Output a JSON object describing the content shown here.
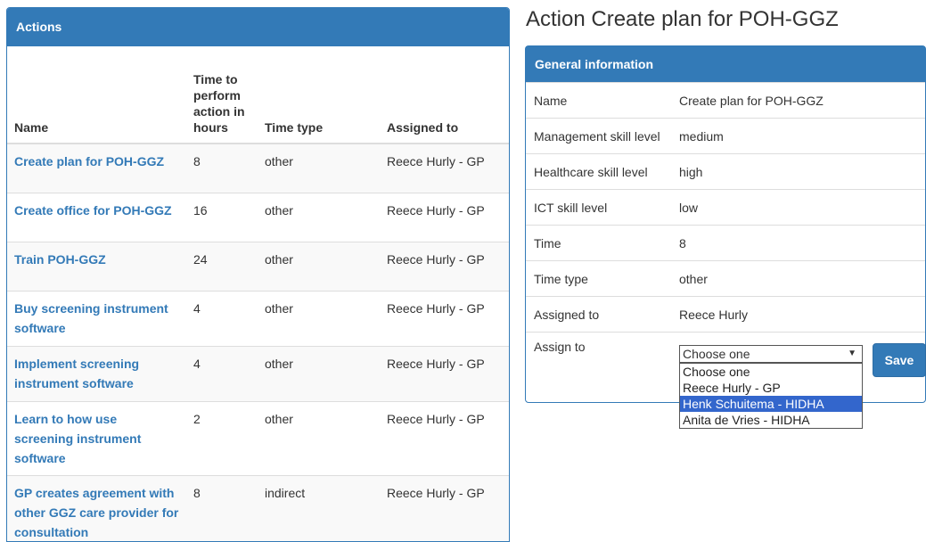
{
  "actions_panel": {
    "heading": "Actions",
    "columns": {
      "name": "Name",
      "time": "Time to perform action in hours",
      "time_type": "Time type",
      "assigned_to": "Assigned to"
    },
    "rows": [
      {
        "name": "Create plan for POH-GGZ",
        "time": "8",
        "time_type": "other",
        "assigned_to": "Reece Hurly - GP"
      },
      {
        "name": "Create office for POH-GGZ",
        "time": "16",
        "time_type": "other",
        "assigned_to": "Reece Hurly - GP"
      },
      {
        "name": "Train POH-GGZ",
        "time": "24",
        "time_type": "other",
        "assigned_to": "Reece Hurly - GP"
      },
      {
        "name": "Buy screening instrument software",
        "time": "4",
        "time_type": "other",
        "assigned_to": "Reece Hurly - GP"
      },
      {
        "name": "Implement screening instrument software",
        "time": "4",
        "time_type": "other",
        "assigned_to": "Reece Hurly - GP"
      },
      {
        "name": "Learn to how use screening instrument software",
        "time": "2",
        "time_type": "other",
        "assigned_to": "Reece Hurly - GP"
      },
      {
        "name": "GP creates agreement with other GGZ care provider for consultation",
        "time": "8",
        "time_type": "indirect",
        "assigned_to": "Reece Hurly - GP"
      }
    ]
  },
  "detail": {
    "title": "Action Create plan for POH-GGZ",
    "panel_heading": "General information",
    "fields": [
      {
        "label": "Name",
        "value": "Create plan for POH-GGZ"
      },
      {
        "label": "Management skill level",
        "value": "medium"
      },
      {
        "label": "Healthcare skill level",
        "value": "high"
      },
      {
        "label": "ICT skill level",
        "value": "low"
      },
      {
        "label": "Time",
        "value": "8"
      },
      {
        "label": "Time type",
        "value": "other"
      },
      {
        "label": "Assigned to",
        "value": "Reece Hurly"
      }
    ],
    "assign_label": "Assign to",
    "select": {
      "selected": "Choose one",
      "options": [
        "Choose one",
        "Reece Hurly - GP",
        "Henk Schuitema - HIDHA",
        "Anita de Vries - HIDHA"
      ],
      "highlighted_option": "Henk Schuitema - HIDHA"
    },
    "save_label": "Save"
  },
  "colors": {
    "primary": "#337ab7",
    "dropdown_highlight": "#3366cc"
  }
}
